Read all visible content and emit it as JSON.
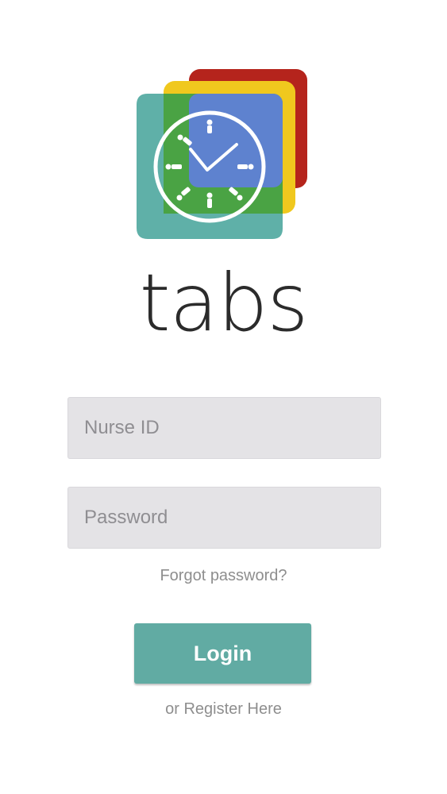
{
  "app": {
    "wordmark": "tabs",
    "logo_icon": "clock-people-logo-icon"
  },
  "form": {
    "nurse_id_placeholder": "Nurse ID",
    "nurse_id_value": "",
    "password_placeholder": "Password",
    "password_value": "",
    "forgot_password_label": "Forgot password?",
    "login_label": "Login",
    "register_label": "or Register Here"
  },
  "colors": {
    "red_tile": "#b5241c",
    "orange_tile": "#d9742b",
    "yellow_tile": "#f0c81e",
    "green_tile": "#4aa344",
    "blue_tile": "#5e82cf",
    "teal_tile": "#5fb0a8",
    "login_button": "#61aba3",
    "field_background": "#e4e3e6",
    "muted_text": "#8e8e8e"
  }
}
